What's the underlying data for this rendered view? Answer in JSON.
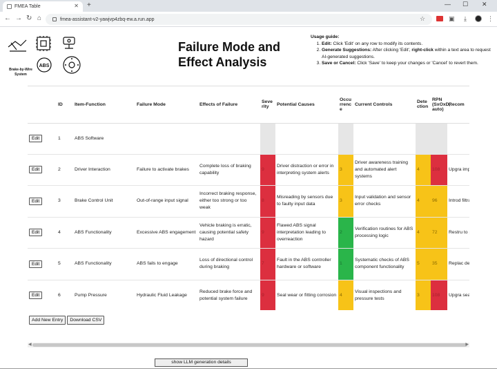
{
  "browser": {
    "tab_title": "FMEA Table",
    "tab_close": "✕",
    "new_tab": "+",
    "url": "fmea-assistant-v2-yawjvp4zbq-ew.a.run.app",
    "win_min": "—",
    "win_max": "☐",
    "win_close": "✕"
  },
  "logo": {
    "caption_line1": "Brake-by-Wire",
    "caption_line2": "System",
    "abs_label": "ABS"
  },
  "page": {
    "title": "Failure Mode and Effect Analysis"
  },
  "guide": {
    "title": "Usage guide:",
    "items": [
      {
        "bold": "Edit:",
        "text": " Click 'Edit' on any row to modify its contents."
      },
      {
        "bold": "Generate Suggestions:",
        "text": " After clicking 'Edit', ",
        "bold2": "right-click",
        "text2": " within a text area to request AI-generated suggestions."
      },
      {
        "bold": "Save or Cancel:",
        "text": " Click 'Save' to keep your changes or 'Cancel' to revert them."
      }
    ]
  },
  "table": {
    "headers": {
      "id": "ID",
      "item": "Item-Function",
      "mode": "Failure Mode",
      "effects": "Effects of Failure",
      "severity": "Severity",
      "causes": "Potential Causes",
      "occurrence": "Occurrence",
      "controls": "Current Controls",
      "detection": "Detection",
      "rpn": "RPN (SxOxD, auto)",
      "recommended": "Recom"
    },
    "edit_label": "Edit",
    "rows": [
      {
        "id": "1",
        "item": "ABS Software",
        "mode": "",
        "effects": "",
        "severity": "",
        "causes": "",
        "occurrence": "",
        "controls": "",
        "detection": "",
        "rpn": "",
        "recommended": ""
      },
      {
        "id": "2",
        "item": "Driver Interaction",
        "mode": "Failure to activate brakes",
        "effects": "Complete loss of braking capability",
        "severity": "9",
        "causes": "Driver distraction or error in interpreting system alerts",
        "occurrence": "3",
        "controls": "Driver awareness training and automated alert systems",
        "detection": "4",
        "rpn": "108",
        "recommended": "Upgra improv interfa"
      },
      {
        "id": "3",
        "item": "Brake Control Unit",
        "mode": "Out-of-range input signal",
        "effects": "Incorrect braking response, either too strong or too weak",
        "severity": "8",
        "causes": "Misreading by sensors due to faulty input data",
        "occurrence": "3",
        "controls": "Input validation and sensor error checks",
        "detection": "4",
        "rpn": "96",
        "recommended": "Introd filtratio techni"
      },
      {
        "id": "4",
        "item": "ABS Functionality",
        "mode": "Excessive ABS engagement",
        "effects": "Vehicle braking is erratic, causing potential safety hazard",
        "severity": "9",
        "causes": "Flawed ABS signal interpretation leading to overreaction",
        "occurrence": "2",
        "controls": "Verification routines for ABS processing logic",
        "detection": "4",
        "rpn": "72",
        "recommended": "Restru to prev engag"
      },
      {
        "id": "5",
        "item": "ABS Functionality",
        "mode": "ABS fails to engage",
        "effects": "Loss of directional control during braking",
        "severity": "7",
        "causes": "Fault in the ABS controller hardware or software",
        "occurrence": "1",
        "controls": "Systematic checks of ABS component functionality",
        "detection": "5",
        "rpn": "35",
        "recommended": "Replac defect"
      },
      {
        "id": "6",
        "item": "Pump Pressure",
        "mode": "Hydraulic Fluid Leakage",
        "effects": "Reduced brake force and potential system failure",
        "severity": "9",
        "causes": "Seal wear or fitting corrosion",
        "occurrence": "4",
        "controls": "Visual inspections and pressure tests",
        "detection": "3",
        "rpn": "108",
        "recommended": "Upgra seals a resista"
      }
    ]
  },
  "actions": {
    "add_entry": "Add New Entry",
    "download_csv": "Download CSV",
    "show_llm": "show LLM generation details"
  },
  "colors": {
    "red": "#dc2f3f",
    "yellow": "#f7c318",
    "green": "#2ab54a",
    "gray": "#e6e6e6"
  }
}
